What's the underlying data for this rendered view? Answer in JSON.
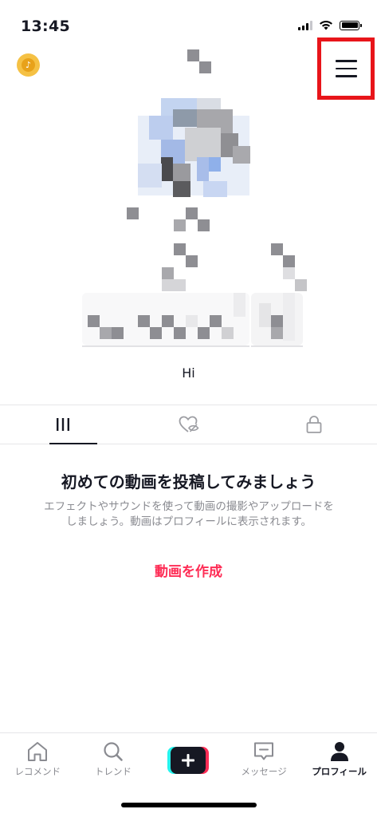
{
  "status_bar": {
    "time": "13:45"
  },
  "profile": {
    "bio": "Hi"
  },
  "empty_state": {
    "title": "初めての動画を投稿してみましょう",
    "description": "エフェクトやサウンドを使って動画の撮影やアップロードをしましょう。動画はプロフィールに表示されます。",
    "action": "動画を作成"
  },
  "bottom_nav": {
    "home": "レコメンド",
    "search": "トレンド",
    "inbox": "メッセージ",
    "profile": "プロフィール"
  },
  "colors": {
    "accent": "#fe2c55",
    "highlight_box": "#e8151a",
    "text": "#161823",
    "muted": "#8a8b91"
  },
  "icons": [
    "coin-icon",
    "menu-icon",
    "videos-grid-icon",
    "liked-hidden-icon",
    "lock-icon",
    "home-icon",
    "search-icon",
    "plus-icon",
    "inbox-icon",
    "person-icon"
  ]
}
